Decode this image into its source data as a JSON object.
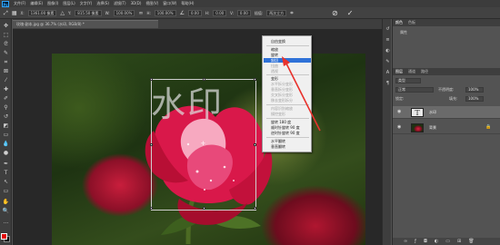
{
  "app": {
    "logo": "Ps",
    "menu": [
      "文件(F)",
      "编辑(E)",
      "图像(I)",
      "图层(L)",
      "文字(Y)",
      "选择(S)",
      "滤镜(T)",
      "3D(D)",
      "视图(V)",
      "窗口(W)",
      "帮助(H)"
    ]
  },
  "options": {
    "x_label": "X:",
    "x_value": "1361.00 像素",
    "y_label": "Y:",
    "y_value": "815.50 像素",
    "w_label": "W:",
    "w_value": "100.00%",
    "h_label": "H:",
    "h_value": "100.00%",
    "angle_value": "0.00",
    "h2_label": "H:",
    "h2_value": "0.00",
    "v_label": "V:",
    "v_value": "0.00",
    "interp_label": "插值:",
    "interp_value": "两次立方"
  },
  "document": {
    "tab_title": "玫瑰-副本.jpg @ 36.7% (水印, RGB/8) *",
    "watermark_text": "水印"
  },
  "context_menu": {
    "items": [
      {
        "label": "自由变换",
        "disabled": false,
        "highlight": false
      },
      {
        "label": "缩放",
        "disabled": false,
        "highlight": false
      },
      {
        "label": "旋转",
        "disabled": false,
        "highlight": false
      },
      {
        "label": "斜切",
        "disabled": false,
        "highlight": true
      },
      {
        "label": "扭曲",
        "disabled": true,
        "highlight": false
      },
      {
        "label": "透视",
        "disabled": true,
        "highlight": false
      },
      {
        "label": "变形",
        "disabled": false,
        "highlight": false
      },
      {
        "label": "水平拆分变形",
        "disabled": true,
        "highlight": false
      },
      {
        "label": "垂直拆分变形",
        "disabled": true,
        "highlight": false
      },
      {
        "label": "交叉拆分变形",
        "disabled": true,
        "highlight": false
      },
      {
        "label": "移去变形拆分",
        "disabled": true,
        "highlight": false
      },
      {
        "label": "内容识别缩放",
        "disabled": true,
        "highlight": false
      },
      {
        "label": "操控变形",
        "disabled": true,
        "highlight": false
      },
      {
        "label": "旋转 180 度",
        "disabled": false,
        "highlight": false
      },
      {
        "label": "顺时针旋转 90 度",
        "disabled": false,
        "highlight": false
      },
      {
        "label": "逆时针旋转 90 度",
        "disabled": false,
        "highlight": false
      },
      {
        "label": "水平翻转",
        "disabled": false,
        "highlight": false
      },
      {
        "label": "垂直翻转",
        "disabled": false,
        "highlight": false
      }
    ]
  },
  "panels": {
    "top_tabs": [
      "颜色",
      "色板"
    ],
    "properties_label": "属性",
    "layers_tabs": [
      "图层",
      "通道",
      "路径"
    ],
    "kind_label": "类型",
    "blend_mode": "正常",
    "opacity_label": "不透明度:",
    "opacity_value": "100%",
    "lock_label": "锁定:",
    "fill_label": "填充:",
    "fill_value": "100%",
    "layers": [
      {
        "name": "水印",
        "thumb": "T",
        "selected": true
      },
      {
        "name": "背景",
        "thumb": "",
        "selected": false
      }
    ]
  },
  "colors": {
    "foreground": "#e00000",
    "background": "#000000",
    "menu_highlight": "#2f72d8",
    "arrow": "#e8322c"
  }
}
